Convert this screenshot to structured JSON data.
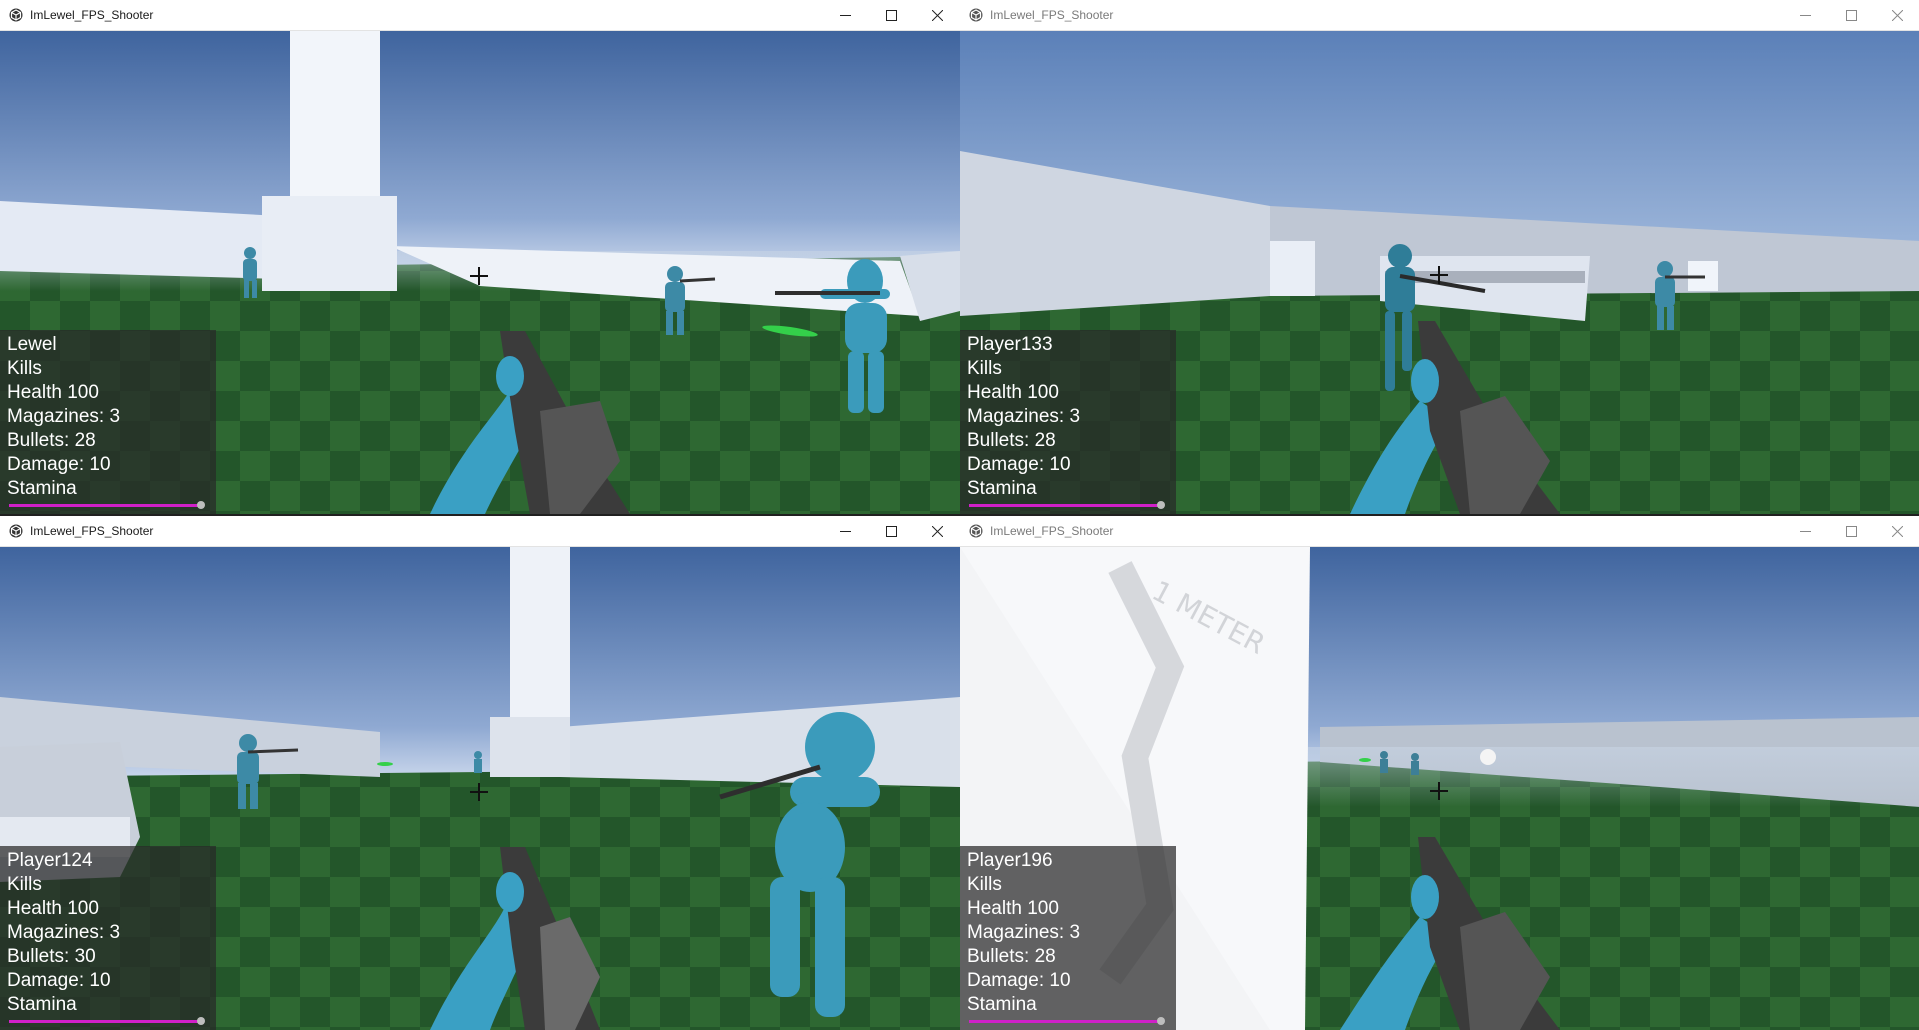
{
  "colors": {
    "sky_top": "#4a6fa8",
    "sky_bottom": "#c9d8ee",
    "grass_dark": "#1f4f24",
    "grass_light": "#2f6a32",
    "wall": "#dfe6f0",
    "character": "#3d9ab8",
    "gun": "#3a3a3a",
    "stamina": "#d020c8",
    "hud_bg": "rgba(40,40,40,0.72)"
  },
  "windows": [
    {
      "title": "ImLewel_FPS_Shooter",
      "active": true,
      "hud": {
        "name": "Lewel",
        "kills": "Kills",
        "health": "Health 100",
        "magazines": "Magazines: 3",
        "bullets": "Bullets: 28",
        "damage": "Damage: 10",
        "stamina": "Stamina",
        "stamina_level": 1.0
      }
    },
    {
      "title": "ImLewel_FPS_Shooter",
      "active": false,
      "hud": {
        "name": "Player133",
        "kills": "Kills",
        "health": "Health 100",
        "magazines": "Magazines: 3",
        "bullets": "Bullets: 28",
        "damage": "Damage: 10",
        "stamina": "Stamina",
        "stamina_level": 1.0
      }
    },
    {
      "title": "ImLewel_FPS_Shooter",
      "active": true,
      "hud": {
        "name": "Player124",
        "kills": "Kills",
        "health": "Health 100",
        "magazines": "Magazines: 3",
        "bullets": "Bullets: 30",
        "damage": "Damage: 10",
        "stamina": "Stamina",
        "stamina_level": 1.0
      }
    },
    {
      "title": "ImLewel_FPS_Shooter",
      "active": false,
      "hud": {
        "name": "Player196",
        "kills": "Kills",
        "health": "Health 100",
        "magazines": "Magazines: 3",
        "bullets": "Bullets: 28",
        "damage": "Damage: 10",
        "stamina": "Stamina",
        "stamina_level": 1.0
      }
    }
  ],
  "signage": {
    "text": "1 METER"
  },
  "icons": {
    "app": "unity-icon",
    "minimize": "minimize-icon",
    "maximize": "maximize-icon",
    "close": "close-icon"
  }
}
